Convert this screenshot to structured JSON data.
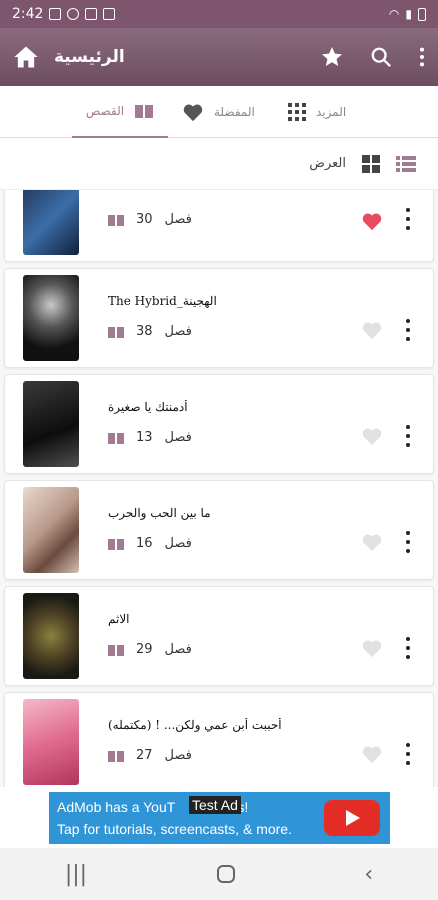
{
  "status": {
    "time": "2:42"
  },
  "appbar": {
    "title": "الرئيسية"
  },
  "tabs": [
    {
      "label": "القصص",
      "active": true
    },
    {
      "label": "المفضلة",
      "active": false
    },
    {
      "label": "المزيد",
      "active": false
    }
  ],
  "view": {
    "label": "العرض"
  },
  "stories": [
    {
      "title": "",
      "chapters": "30",
      "chapter_label": "فصل",
      "favorite": true
    },
    {
      "title": "The Hybrid_الهجينة",
      "chapters": "38",
      "chapter_label": "فصل",
      "favorite": false
    },
    {
      "title": "أدمنتك يا صغيرة",
      "chapters": "13",
      "chapter_label": "فصل",
      "favorite": false
    },
    {
      "title": "ما بين الحب والحرب",
      "chapters": "16",
      "chapter_label": "فصل",
      "favorite": false
    },
    {
      "title": "الاثم",
      "chapters": "29",
      "chapter_label": "فصل",
      "favorite": false
    },
    {
      "title": "أحببت أبن عمي ولكن... ! (مكتمله)",
      "chapters": "27",
      "chapter_label": "فصل",
      "favorite": false
    }
  ],
  "ad": {
    "line1_start": "AdMob has a YouT",
    "line1_end": "s!",
    "line2": "Tap for tutorials, screencasts, & more.",
    "badge": "Test Ad"
  },
  "colors": {
    "primary": "#7d566d",
    "accent": "#a07b92",
    "heart_active": "#e84a5f"
  }
}
